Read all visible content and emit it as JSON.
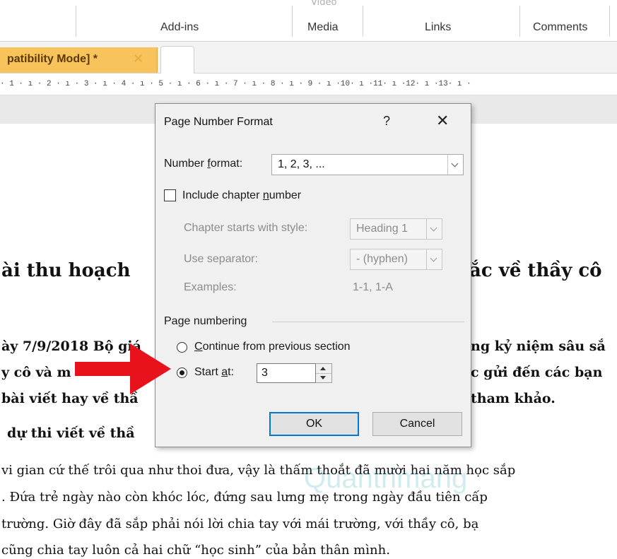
{
  "ribbon": {
    "video_label": "Video",
    "groups": [
      {
        "label": "Add-ins"
      },
      {
        "label": "Media"
      },
      {
        "label": "Links"
      },
      {
        "label": "Comments"
      }
    ]
  },
  "tabs": {
    "document_tab": "patibility Mode] *",
    "close_glyph": "✕"
  },
  "ruler": {
    "text": "· 1 · ı · 2 · ı · 3 · ı · 4 · ı · 5 · ı · 6 · ı · 7 · ı · 8 · ı · 9 · ı ·10· ı ·11· ı ·12· ı ·13· ı ·"
  },
  "document": {
    "heading_left": "ài thu hoạch",
    "heading_right": "ắc về thầy cô",
    "para1": [
      {
        "left": "ày 7/9/2018 Bộ giá",
        "right": "ng kỷ niệm sâu sắ"
      },
      {
        "left": "y cô và m",
        "right": "c gửi đến các bạn"
      },
      {
        "left": "bài viết hay về thầ",
        "right": "tham khảo."
      }
    ],
    "subheading": "dự thi viết về thầ",
    "para2": [
      "vi gian cứ thế trôi qua như thoi đưa, vậy là thấm thoắt đã mười hai năm học sắp",
      ". Đứa trẻ ngày nào còn khóc lóc, đứng sau lưng mẹ trong ngày đầu tiên cấp",
      " trường. Giờ đây đã sắp phải nói lời chia tay với mái trường, với thầy cô, bạ",
      "cũng chia tay luôn cả hai chữ “học sinh” của bản thân mình."
    ],
    "watermark": "Quantrimang"
  },
  "dialog": {
    "title": "Page Number Format",
    "help_glyph": "?",
    "close_glyph": "✕",
    "number_format": {
      "label_pre": "Number ",
      "label_key": "f",
      "label_post": "ormat:",
      "value": "1, 2, 3, ..."
    },
    "include_chapter": {
      "label_pre": "Include chapter ",
      "label_key": "n",
      "label_post": "umber",
      "checked": false
    },
    "chapter_style": {
      "label": "Chapter starts with style:",
      "value": "Heading 1"
    },
    "separator": {
      "label": "Use separator:",
      "value": "-   (hyphen)"
    },
    "examples": {
      "label": "Examples:",
      "value": "1-1, 1-A"
    },
    "page_numbering": {
      "label": "Page numbering",
      "continue_pre": "",
      "continue_key": "C",
      "continue_post": "ontinue from previous section",
      "start_pre": "Start ",
      "start_key": "a",
      "start_post": "t:",
      "start_value": "3",
      "selected": "start_at"
    },
    "ok_label": "OK",
    "cancel_label": "Cancel"
  },
  "colors": {
    "doc_tab": "#f7c35a",
    "arrow": "#e8121c",
    "default_button_border": "#0078d7"
  }
}
